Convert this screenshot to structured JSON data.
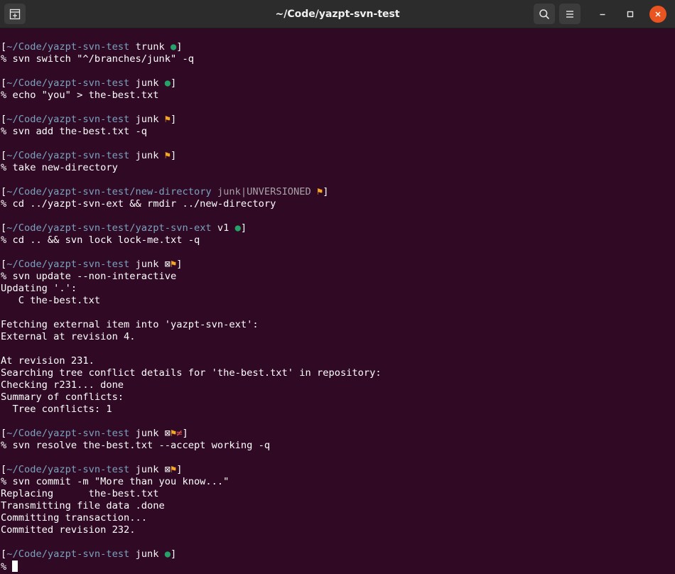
{
  "window": {
    "title": "~/Code/yazpt-svn-test"
  },
  "titlebar": {
    "new_tab_icon": "new-tab-icon",
    "search_icon": "search-icon",
    "menu_icon": "hamburger-menu-icon",
    "minimize_icon": "minimize-icon",
    "maximize_icon": "maximize-icon",
    "close_icon": "close-icon"
  },
  "colors": {
    "background": "#300a24",
    "path": "#7aa2bf",
    "clean_status": "#26a269",
    "dirty_status": "#f5a623",
    "conflict_status": "#e2585a",
    "close_button": "#e95420"
  },
  "terminal": {
    "blocks": [
      {
        "prompt": {
          "path": "~/Code/yazpt-svn-test",
          "branch": "trunk",
          "status": "●"
        },
        "command": "% svn switch \"^/branches/junk\" -q",
        "output": []
      },
      {
        "prompt": {
          "path": "~/Code/yazpt-svn-test",
          "branch": "junk",
          "status": "●"
        },
        "command": "% echo \"you\" > the-best.txt",
        "output": []
      },
      {
        "prompt": {
          "path": "~/Code/yazpt-svn-test",
          "branch": "junk",
          "status": "⚑"
        },
        "command": "% svn add the-best.txt -q",
        "output": []
      },
      {
        "prompt": {
          "path": "~/Code/yazpt-svn-test",
          "branch": "junk",
          "status": "⚑"
        },
        "command": "% take new-directory",
        "output": []
      },
      {
        "prompt": {
          "path": "~/Code/yazpt-svn-test/new-directory",
          "branch": "junk|UNVERSIONED",
          "status": "⚑"
        },
        "command": "% cd ../yazpt-svn-ext && rmdir ../new-directory",
        "output": []
      },
      {
        "prompt": {
          "path": "~/Code/yazpt-svn-test/yazpt-svn-ext",
          "branch": "v1",
          "status": "●"
        },
        "command": "% cd .. && svn lock lock-me.txt -q",
        "output": []
      },
      {
        "prompt": {
          "path": "~/Code/yazpt-svn-test",
          "branch": "junk",
          "status": "⊠⚑"
        },
        "command": "% svn update --non-interactive",
        "output": [
          "Updating '.':",
          "   C the-best.txt",
          "",
          "Fetching external item into 'yazpt-svn-ext':",
          "External at revision 4.",
          "",
          "At revision 231.",
          "Searching tree conflict details for 'the-best.txt' in repository:",
          "Checking r231... done",
          "Summary of conflicts:",
          "  Tree conflicts: 1"
        ]
      },
      {
        "prompt": {
          "path": "~/Code/yazpt-svn-test",
          "branch": "junk",
          "status": "⊠⚑≠"
        },
        "command": "% svn resolve the-best.txt --accept working -q",
        "output": []
      },
      {
        "prompt": {
          "path": "~/Code/yazpt-svn-test",
          "branch": "junk",
          "status": "⊠⚑"
        },
        "command": "% svn commit -m \"More than you know...\"",
        "output": [
          "Replacing      the-best.txt",
          "Transmitting file data .done",
          "Committing transaction...",
          "Committed revision 232."
        ]
      },
      {
        "prompt": {
          "path": "~/Code/yazpt-svn-test",
          "branch": "junk",
          "status": "●"
        },
        "command": "% ",
        "output": []
      }
    ]
  }
}
